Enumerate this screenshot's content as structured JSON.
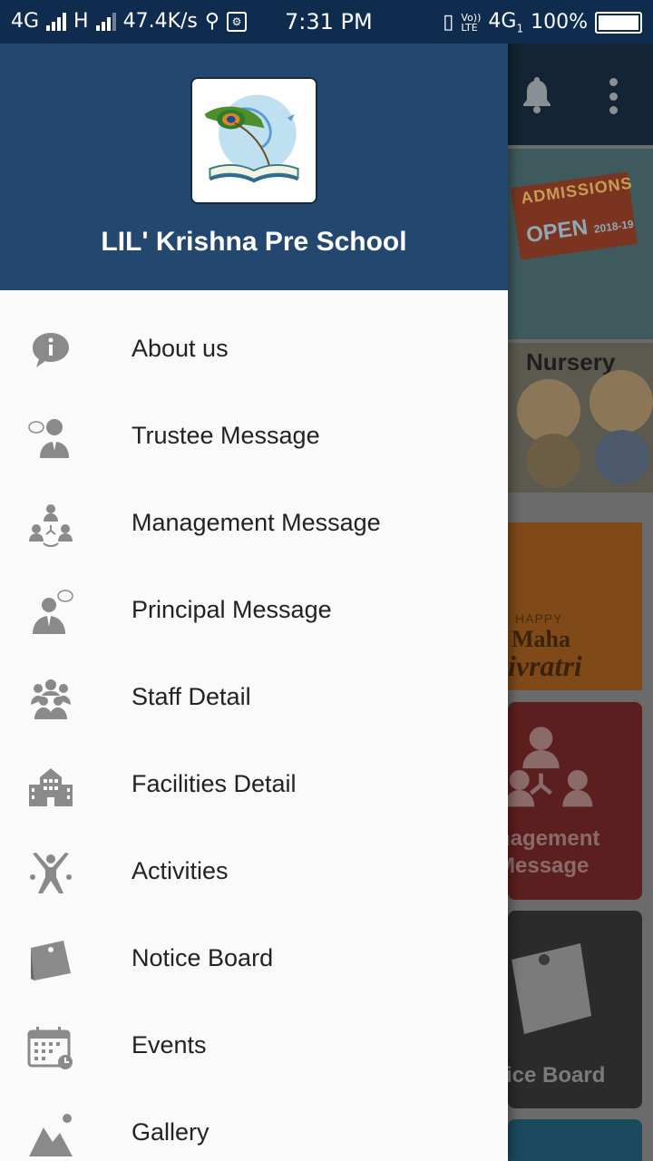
{
  "status_bar": {
    "network1": "4G",
    "network2": "H",
    "speed": "47.4K/s",
    "time": "7:31 PM",
    "volte": "Vo)) LTE",
    "network3": "4G",
    "sim_index": "1",
    "battery": "100%"
  },
  "drawer": {
    "school_name": "LIL' Krishna Pre School",
    "menu": [
      {
        "label": "About us",
        "icon": "info-chat-icon"
      },
      {
        "label": "Trustee Message",
        "icon": "trustee-icon"
      },
      {
        "label": "Management Message",
        "icon": "management-icon"
      },
      {
        "label": "Principal Message",
        "icon": "principal-icon"
      },
      {
        "label": "Staff Detail",
        "icon": "staff-group-icon"
      },
      {
        "label": "Facilities Detail",
        "icon": "building-icon"
      },
      {
        "label": "Activities",
        "icon": "activities-icon"
      },
      {
        "label": "Notice Board",
        "icon": "notice-board-icon"
      },
      {
        "label": "Events",
        "icon": "calendar-icon"
      },
      {
        "label": "Gallery",
        "icon": "gallery-icon"
      }
    ]
  },
  "background_app": {
    "admissions_line1": "ADMISSIONS",
    "admissions_line2": "OPEN",
    "admissions_year": "2018-19",
    "nursery_label": "Nursery",
    "happy_label": "HAPPY",
    "maha_label": "Maha",
    "ratri_label": "ivratri",
    "management_tile_line1": "nagement",
    "management_tile_line2": "Message",
    "notice_tile_label": "tice Board"
  },
  "colors": {
    "drawer_header": "#23476f",
    "status_bar": "#0f2b4e",
    "icon_gray": "#8a8a8a",
    "menu_text": "#222222"
  }
}
